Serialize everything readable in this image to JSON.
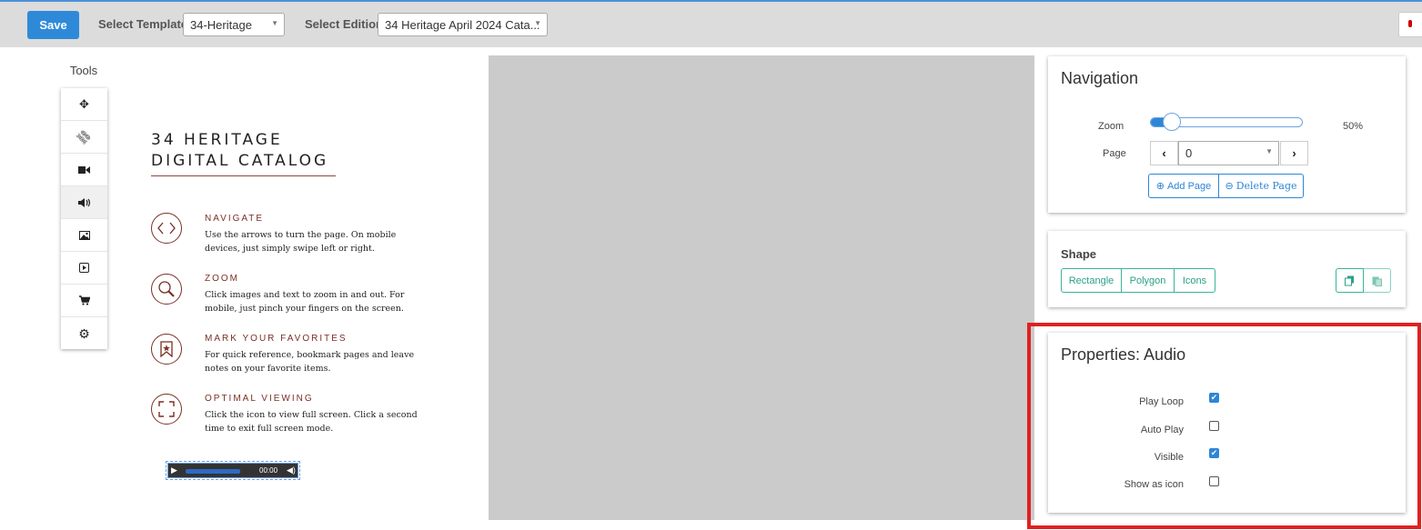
{
  "toolbar": {
    "save_label": "Save",
    "template_label": "Select Template",
    "template_value": "34-Heritage",
    "edition_label": "Select Edition",
    "edition_value": "34 Heritage April 2024 Cata..."
  },
  "tools": {
    "title": "Tools",
    "items": [
      {
        "name": "move-icon",
        "glyph": "✥"
      },
      {
        "name": "link-icon",
        "glyph": "⛓"
      },
      {
        "name": "video-icon",
        "glyph": "■"
      },
      {
        "name": "audio-icon",
        "glyph": "◀)"
      },
      {
        "name": "image-icon",
        "glyph": "▣"
      },
      {
        "name": "media-icon",
        "glyph": "▶"
      },
      {
        "name": "cart-icon",
        "glyph": "⛟"
      },
      {
        "name": "gear-icon",
        "glyph": "⚙"
      }
    ]
  },
  "catalog": {
    "title_line1": "34 HERITAGE",
    "title_line2": "DIGITAL CATALOG",
    "features": [
      {
        "icon": "‹ ›",
        "heading": "NAVIGATE",
        "text": "Use the arrows to turn the page. On mobile devices, just simply swipe left or right."
      },
      {
        "icon": "🔍",
        "heading": "ZOOM",
        "text": "Click images and  text to zoom in and out. For mobile, just pinch your fingers on the screen."
      },
      {
        "icon": "★",
        "heading": "MARK YOUR FAVORITES",
        "text": "For quick reference, bookmark pages and leave notes on your favorite items."
      },
      {
        "icon": "⛶",
        "heading": "OPTIMAL VIEWING",
        "text": "Click the icon to view full screen. Click a second time to exit full screen mode."
      }
    ],
    "audio_time": "00:00"
  },
  "navigation": {
    "title": "Navigation",
    "zoom_label": "Zoom",
    "zoom_value": "50%",
    "zoom_fraction": 0.14,
    "page_label": "Page",
    "page_value": "0",
    "add_page": "Add Page",
    "delete_page": "Delete Page"
  },
  "shape": {
    "title": "Shape",
    "buttons": [
      "Rectangle",
      "Polygon",
      "Icons"
    ]
  },
  "properties": {
    "title": "Properties: Audio",
    "items": [
      {
        "label": "Play Loop",
        "checked": true
      },
      {
        "label": "Auto Play",
        "checked": false
      },
      {
        "label": "Visible",
        "checked": true
      },
      {
        "label": "Show as icon",
        "checked": false
      }
    ]
  },
  "colors": {
    "primary": "#2e8ad8",
    "accent_teal": "#3ab39a",
    "catalog_brown": "#7a2f24",
    "highlight_red": "#e02020"
  }
}
